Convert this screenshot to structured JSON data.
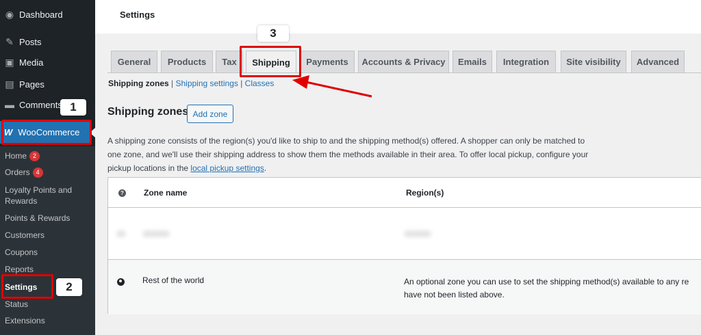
{
  "sidebar": {
    "menu": [
      {
        "label": "Dashboard",
        "icon": "dashboard-icon"
      },
      {
        "label": "Posts",
        "icon": "pin-icon"
      },
      {
        "label": "Media",
        "icon": "media-icon"
      },
      {
        "label": "Pages",
        "icon": "page-icon"
      },
      {
        "label": "Comments",
        "icon": "comment-icon"
      }
    ],
    "woocommerce": {
      "logo": "W",
      "label": "WooCommerce"
    },
    "submenu": [
      {
        "label": "Home",
        "badge": "2"
      },
      {
        "label": "Orders",
        "badge": "4"
      },
      {
        "label": "Loyalty Points and Rewards"
      },
      {
        "label": "Points & Rewards"
      },
      {
        "label": "Customers"
      },
      {
        "label": "Coupons"
      },
      {
        "label": "Reports"
      },
      {
        "label": "Settings"
      },
      {
        "label": "Status"
      },
      {
        "label": "Extensions"
      }
    ]
  },
  "header": {
    "title": "Settings"
  },
  "tabs": [
    {
      "label": "General"
    },
    {
      "label": "Products"
    },
    {
      "label": "Tax"
    },
    {
      "label": "Shipping"
    },
    {
      "label": "Payments"
    },
    {
      "label": "Accounts & Privacy"
    },
    {
      "label": "Emails"
    },
    {
      "label": "Integration"
    },
    {
      "label": "Site visibility"
    },
    {
      "label": "Advanced"
    }
  ],
  "subsub": {
    "current": "Shipping zones",
    "sep1": " | ",
    "settings": "Shipping settings",
    "sep2": " | ",
    "classes": "Classes"
  },
  "section": {
    "title": "Shipping zones",
    "add_button": "Add zone",
    "desc_text": "A shipping zone consists of the region(s) you'd like to ship to and the shipping method(s) offered. A shopper can only be matched to one zone, and we'll use their shipping address to show them the methods available in their area. To offer local pickup, configure your pickup locations in the ",
    "desc_link": "local pickup settings",
    "desc_end": "."
  },
  "table": {
    "help_icon": "?",
    "headers": {
      "zone_name": "Zone name",
      "regions": "Region(s)"
    },
    "rest_row": {
      "name": "Rest of the world",
      "desc_line1": "An optional zone you can use to set the shipping method(s) available to any re",
      "desc_line2": "have not been listed above."
    }
  },
  "annotations": {
    "step1": "1",
    "step2": "2",
    "step3": "3",
    "color": "#e00000"
  },
  "colors": {
    "accent": "#2271b1",
    "sidebar_bg": "#1d2327",
    "badge": "#d63638"
  }
}
